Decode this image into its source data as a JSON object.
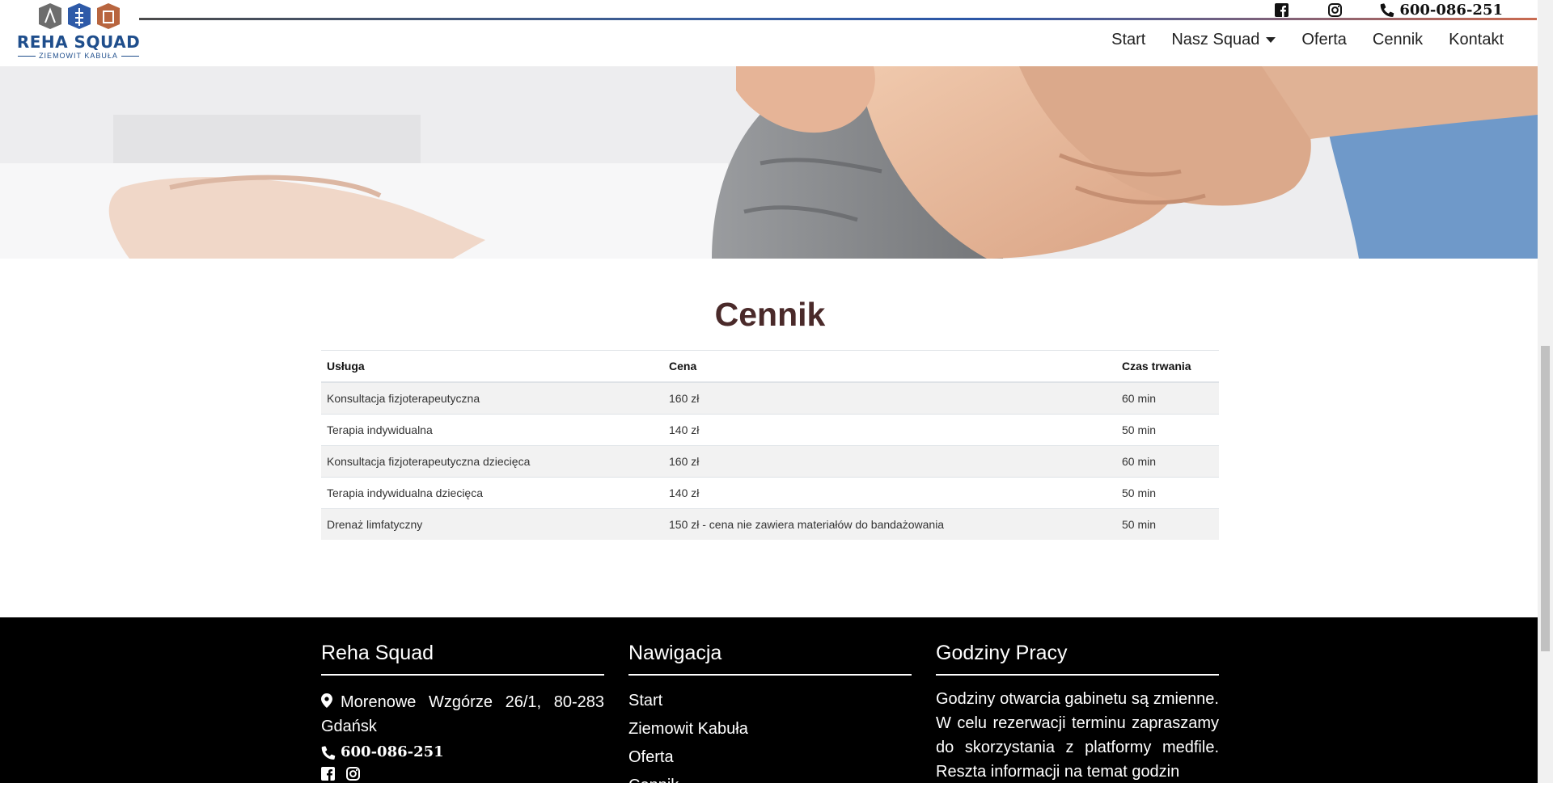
{
  "header": {
    "logo_name": "REHA SQUAD",
    "logo_sub": "ZIEMOWIT KABUŁA",
    "phone": "600-086-251",
    "social_icons": [
      "facebook-icon",
      "instagram-icon"
    ],
    "nav": {
      "start": "Start",
      "squad": "Nasz Squad",
      "oferta": "Oferta",
      "cennik": "Cennik",
      "kontakt": "Kontakt"
    }
  },
  "pricing": {
    "title": "Cennik",
    "columns": [
      "Usługa",
      "Cena",
      "Czas trwania"
    ],
    "rows": [
      [
        "Konsultacja fizjoterapeutyczna",
        "160 zł",
        "60 min"
      ],
      [
        "Terapia indywidualna",
        "140 zł",
        "50 min"
      ],
      [
        "Konsultacja fizjoterapeutyczna dziecięca",
        "160 zł",
        "60 min"
      ],
      [
        "Terapia indywidualna dziecięca",
        "140 zł",
        "50 min"
      ],
      [
        "Drenaż limfatyczny",
        "150 zł - cena nie zawiera materiałów do bandażowania",
        "50 min"
      ]
    ]
  },
  "footer": {
    "col1": {
      "title": "Reha Squad",
      "address": "Morenowe Wzgórze 26/1, 80-283 Gdańsk",
      "phone": "600-086-251"
    },
    "col2": {
      "title": "Nawigacja",
      "links": [
        "Start",
        "Ziemowit Kabuła",
        "Oferta",
        "Cennik"
      ]
    },
    "col3": {
      "title": "Godziny Pracy",
      "text": "Godziny otwarcia gabinetu są zmienne. W celu rezerwacji terminu zapraszamy do skorzystania z platformy medfile. Reszta informacji na temat godzin"
    }
  },
  "colors": {
    "brand_blue": "#1f4e8c",
    "title": "#4a2a2a",
    "footer_bg": "#000000"
  }
}
